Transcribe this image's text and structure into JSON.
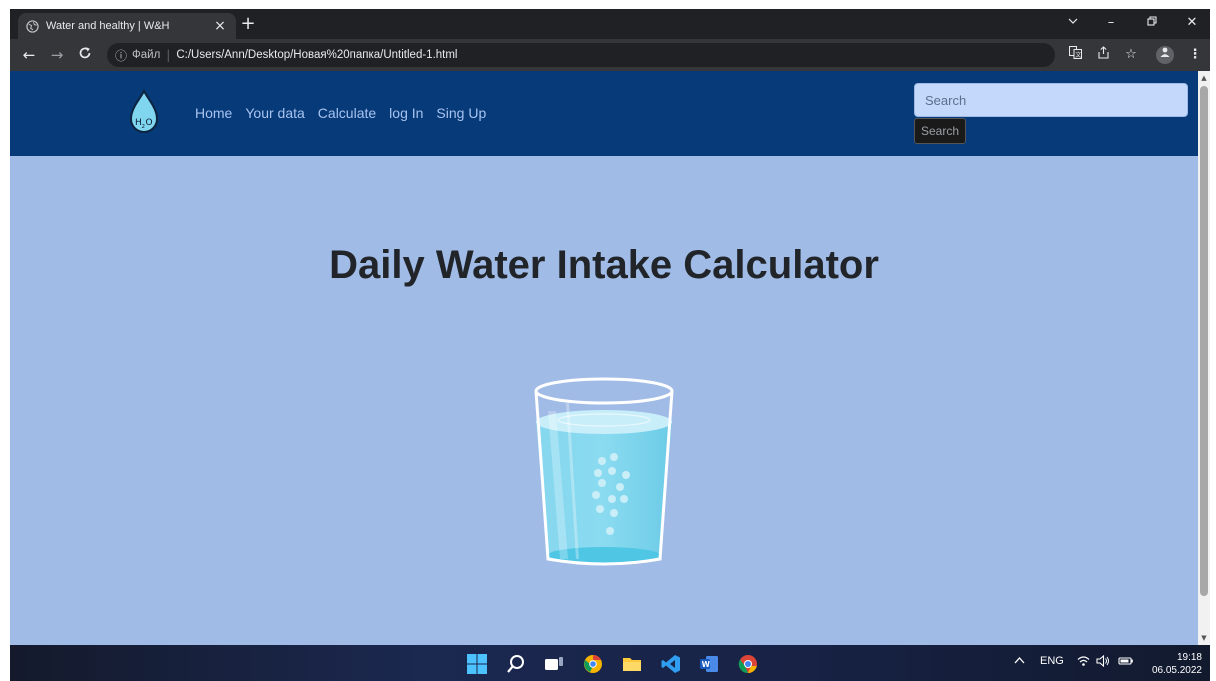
{
  "browser": {
    "tab_title": "Water and healthy | W&H",
    "address_prefix": "Файл",
    "address_url": "C:/Users/Ann/Desktop/Новая%20папка/Untitled-1.html"
  },
  "navbar": {
    "logo_text": "H2O",
    "items": [
      {
        "label": "Home"
      },
      {
        "label": "Your data"
      },
      {
        "label": "Calculate"
      },
      {
        "label": "log In"
      },
      {
        "label": "Sing Up"
      }
    ],
    "search_placeholder": "Search",
    "search_button": "Search"
  },
  "main": {
    "title": "Daily Water Intake Calculator"
  },
  "taskbar": {
    "language": "ENG",
    "time": "19:18",
    "date": "06.05.2022"
  },
  "colors": {
    "navbar_bg": "#063a78",
    "page_bg": "#a0bbe6",
    "nav_link": "#a8c3f0",
    "search_bg": "#c4d8fb",
    "water": "#7fd6ee"
  }
}
